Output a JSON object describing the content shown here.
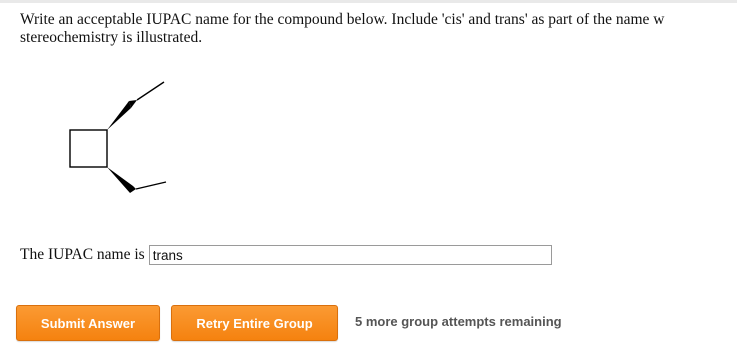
{
  "question": {
    "line1": "Write an acceptable IUPAC name for the compound below. Include 'cis' and trans' as part of the name w",
    "line2": "stereochemistry is illustrated."
  },
  "structure": {
    "description_icon": "trans-1,2-diethylcyclobutane-skeletal-structure"
  },
  "answer": {
    "label": "The IUPAC name is",
    "value": "trans",
    "placeholder": ""
  },
  "actions": {
    "submit_label": "Submit Answer",
    "retry_label": "Retry Entire Group",
    "attempts_text": "5 more group attempts remaining"
  },
  "colors": {
    "button_orange": "#f5820f",
    "attempts_gray": "#555555"
  }
}
